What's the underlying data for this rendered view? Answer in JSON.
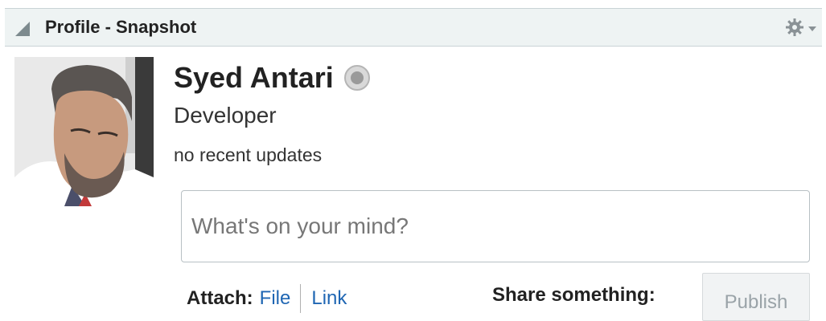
{
  "panel": {
    "title": "Profile - Snapshot",
    "collapse_icon": "triangle-collapse-icon",
    "menu_icon": "gear-dropdown-icon"
  },
  "profile": {
    "name": "Syed Antari",
    "role": "Developer",
    "status": "no recent updates",
    "presence_icon": "presence-offline-icon"
  },
  "composer": {
    "placeholder": "What's on your mind?",
    "value": "",
    "attach_label": "Attach:",
    "file_link": "File",
    "link_link": "Link",
    "share_label": "Share something:",
    "publish_label": "Publish"
  },
  "colors": {
    "header_bg": "#eef3f3",
    "link": "#1f66b3",
    "publish_disabled_text": "#9aa3a8"
  }
}
